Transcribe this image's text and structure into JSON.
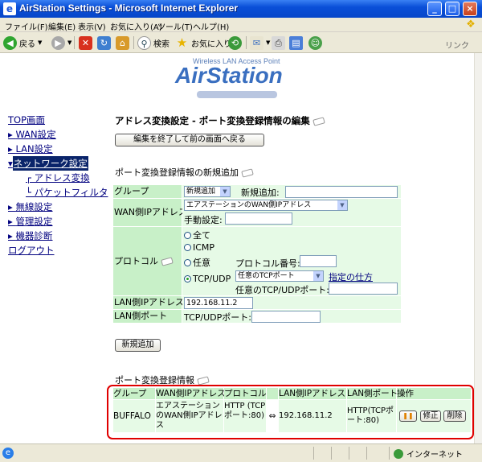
{
  "window": {
    "title": "AirStation Settings - Microsoft Internet Explorer"
  },
  "menu": [
    "ファイル(F)",
    "編集(E)",
    "表示(V)",
    "お気に入り(A)",
    "ツール(T)",
    "ヘルプ(H)"
  ],
  "toolbar": {
    "back": "戻る",
    "search": "検索",
    "favorites": "お気に入り",
    "links": "リンク"
  },
  "logo": {
    "subtitle": "Wireless LAN Access Point",
    "name": "AirStation"
  },
  "nav": {
    "top": "TOP画面",
    "wan": "WAN設定",
    "lan": "LAN設定",
    "network": "ネットワーク設定",
    "nat": "アドレス変換",
    "packet_filter": "パケットフィルタ",
    "wireless": "無線設定",
    "admin": "管理設定",
    "diagnostics": "機器診断",
    "logout": "ログアウト"
  },
  "page": {
    "title": "アドレス変換設定 - ポート変換登録情報の編集",
    "back_button": "編集を終了して前の画面へ戻る",
    "new_section_title": "ポート変換登録情報の新規追加",
    "add_button": "新規追加",
    "list_section_title": "ポート変換登録情報"
  },
  "form": {
    "group_label": "グループ",
    "group_select": "新規追加",
    "new_add_label": "新規追加:",
    "new_add_value": "",
    "wan_label": "WAN側IPアドレス",
    "wan_select": "エアステーションのWAN側IPアドレス",
    "manual_label": "手動設定:",
    "manual_value": "",
    "protocol_label": "プロトコル",
    "opt_all": "全て",
    "opt_icmp": "ICMP",
    "opt_any": "任意",
    "proto_num_label": "プロトコル番号:",
    "proto_num_value": "",
    "opt_tcpudp": "TCP/UDP",
    "tcp_port_select": "任意のTCPポート",
    "how_to_link": "指定の仕方",
    "any_port_label": "任意のTCP/UDPポート:",
    "any_port_value": "",
    "lan_ip_label": "LAN側IPアドレス",
    "lan_ip_value": "192.168.11.2",
    "lan_port_label": "LAN側ポート",
    "lan_port_field_label": "TCP/UDPポート:",
    "lan_port_value": ""
  },
  "table": {
    "headers": [
      "グループ",
      "WAN側IPアドレス",
      "プロトコル",
      "LAN側IPアドレス",
      "LAN側ポート",
      "操作"
    ],
    "rows": [
      {
        "group": "BUFFALO",
        "wan_ip": "エアステーションのWAN側IPアドレス",
        "protocol": "HTTP (TCPポート:80)",
        "arrow": "⇔",
        "lan_ip": "192.168.11.2",
        "lan_port": "HTTP(TCPポート:80)",
        "pause": "❚❚",
        "edit": "修正",
        "delete": "削除"
      }
    ]
  },
  "status": {
    "zone": "インターネット"
  },
  "colors": {
    "label_bg": "#c8f0c8",
    "value_bg": "#e6fae6",
    "highlight_border": "#e00000",
    "logo": "#3a6fc0"
  }
}
